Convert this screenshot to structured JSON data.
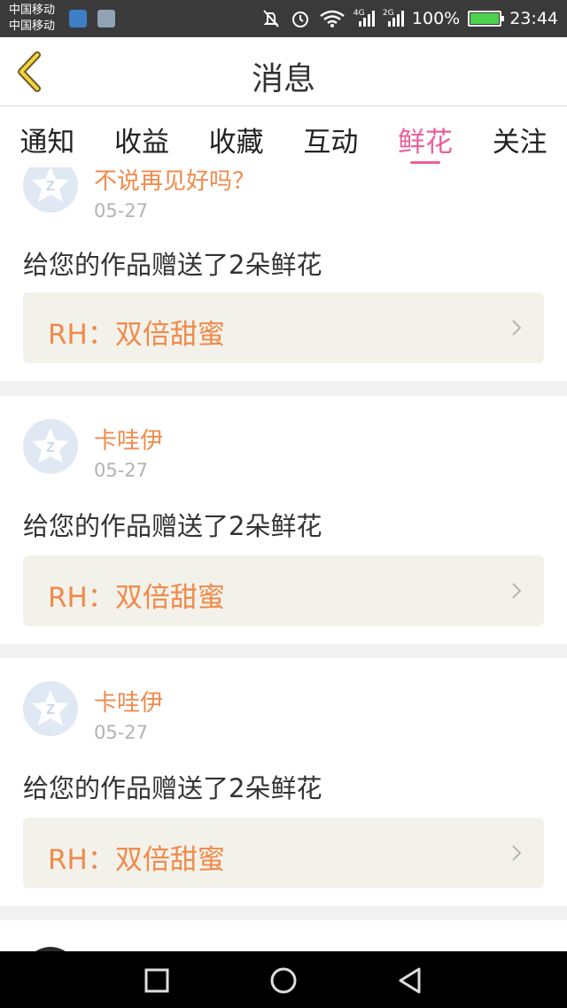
{
  "status_bar": {
    "carrier1": "中国移动",
    "carrier2": "中国移动",
    "net1": "4G",
    "net2": "2G",
    "battery": "100%",
    "time": "23:44"
  },
  "header": {
    "title": "消息"
  },
  "tabs": [
    {
      "label": "通知",
      "active": false
    },
    {
      "label": "收益",
      "active": false
    },
    {
      "label": "收藏",
      "active": false
    },
    {
      "label": "互动",
      "active": false
    },
    {
      "label": "鲜花",
      "active": true
    },
    {
      "label": "关注",
      "active": false
    }
  ],
  "feed": [
    {
      "name": "不说再见好吗？",
      "date": "05-27",
      "message": "给您的作品赠送了2朵鲜花",
      "work": "RH：双倍甜蜜"
    },
    {
      "name": "卡哇伊",
      "date": "05-27",
      "message": "给您的作品赠送了2朵鲜花",
      "work": "RH：双倍甜蜜"
    },
    {
      "name": "卡哇伊",
      "date": "05-27",
      "message": "给您的作品赠送了2朵鲜花",
      "work": "RH：双倍甜蜜"
    }
  ],
  "colors": {
    "accent": "#e8619b",
    "name": "#f08a4b"
  },
  "icons": [
    "back-chevron-icon",
    "mute-icon",
    "alarm-icon",
    "wifi-icon",
    "signal-icon",
    "battery-icon",
    "square-nav-icon",
    "circle-nav-icon",
    "triangle-back-nav-icon",
    "chevron-right-icon"
  ]
}
